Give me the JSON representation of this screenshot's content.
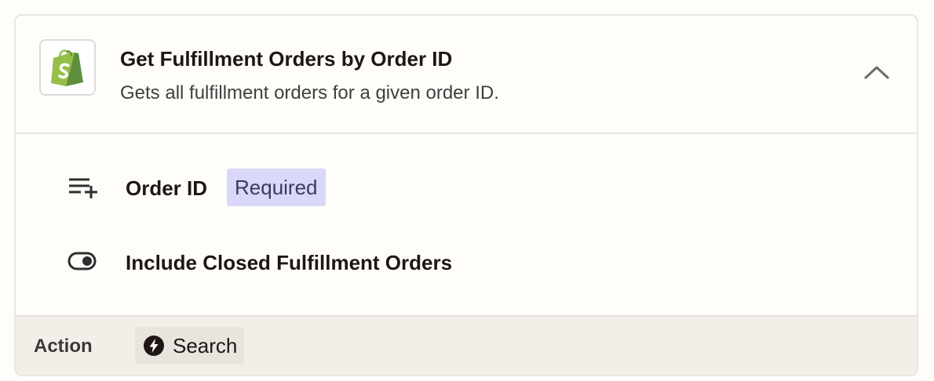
{
  "step": {
    "app_icon": "shopify-bag-icon",
    "title": "Get Fulfillment Orders by Order ID",
    "description": "Gets all fulfillment orders for a given order ID.",
    "collapse_icon": "chevron-up-icon"
  },
  "fields": [
    {
      "icon": "playlist-add-icon",
      "label": "Order ID",
      "badge": "Required"
    },
    {
      "icon": "toggle-icon",
      "label": "Include Closed Fulfillment Orders"
    }
  ],
  "footer": {
    "label": "Action",
    "chip_icon": "lightning-bolt-icon",
    "chip_label": "Search"
  },
  "colors": {
    "shopify_green": "#95bf47",
    "required_badge_bg": "#d9d8f9",
    "footer_bg": "#f2efe9"
  }
}
